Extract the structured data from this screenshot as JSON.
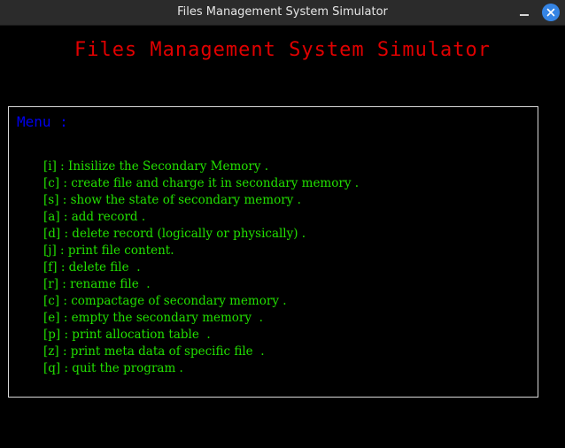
{
  "window": {
    "title": "Files Management System Simulator",
    "close_icon": "close-icon",
    "minimize_icon": "minimize-icon"
  },
  "app": {
    "title": "Files Management System Simulator",
    "title_color": "#e00000"
  },
  "menu": {
    "heading": "Menu :",
    "heading_color": "#0000ee",
    "item_color": "#22e000",
    "items": [
      {
        "label": "[i] : Inisilize the Secondary Memory ."
      },
      {
        "label": "[c] : create file and charge it in secondary memory ."
      },
      {
        "label": "[s] : show the state of secondary memory ."
      },
      {
        "label": "[a] : add record ."
      },
      {
        "label": "[d] : delete record (logically or physically) ."
      },
      {
        "label": "[j] : print file content."
      },
      {
        "label": "[f] : delete file  ."
      },
      {
        "label": "[r] : rename file  ."
      },
      {
        "label": "[c] : compactage of secondary memory ."
      },
      {
        "label": "[e] : empty the secondary memory  ."
      },
      {
        "label": "[p] : print allocation table  ."
      },
      {
        "label": "[z] : print meta data of specific file  ."
      },
      {
        "label": "[q] : quit the program ."
      }
    ]
  }
}
